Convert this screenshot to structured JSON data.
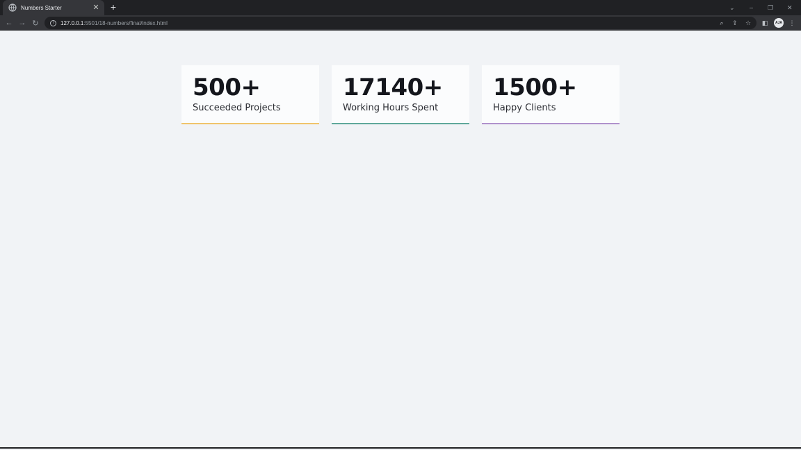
{
  "browser": {
    "tab_title": "Numbers Starter",
    "tab_close": "✕",
    "new_tab": "+",
    "url_host": "127.0.0.1",
    "url_rest": ":5501/18-numbers/final/index.html",
    "profile_initials": "AJA"
  },
  "stats": [
    {
      "value": "500+",
      "label": "Succeeded Projects",
      "accent": "#f0c46c"
    },
    {
      "value": "17140+",
      "label": "Working Hours Spent",
      "accent": "#5fa89b"
    },
    {
      "value": "1500+",
      "label": "Happy Clients",
      "accent": "#b092cc"
    }
  ]
}
